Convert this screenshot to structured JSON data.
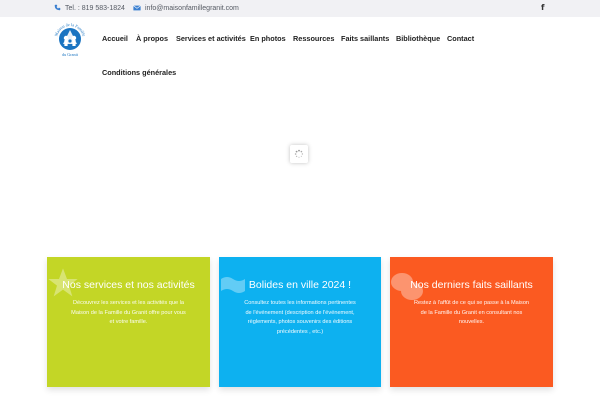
{
  "topbar": {
    "phone": "Tel. : 819 583-1824",
    "email": "info@maisonfamillegranit.com",
    "phone_icon": "phone-icon",
    "email_icon": "envelope-icon",
    "social_icon": "facebook-icon"
  },
  "logo": {
    "text_top": "Maison de la Famille",
    "text_bottom": "du Granit",
    "color": "#1a74c1"
  },
  "nav": {
    "items": [
      {
        "label": "Accueil"
      },
      {
        "label": "À propos"
      },
      {
        "label": "Services et activités"
      },
      {
        "label": "En photos"
      },
      {
        "label": "Ressources"
      },
      {
        "label": "Faits saillants"
      },
      {
        "label": "Bibliothèque"
      },
      {
        "label": "Contact"
      },
      {
        "label": "Conditions générales"
      }
    ]
  },
  "cards": [
    {
      "title": "Nos services et nos activités",
      "description": "Découvrez les services et les activités que la Maison de la Famille du Granit offre pour vous et votre famille.",
      "color": "#c3d626",
      "icon": "star-icon"
    },
    {
      "title": "Bolides en ville 2024 !",
      "description": "Consultez toutes les informations pertinentes de l'événement (description de l'événement, règlements, photos souvenirs des éditions précédentes , etc.)",
      "color": "#0db1f0",
      "icon": "flag-icon"
    },
    {
      "title": "Nos derniers faits saillants",
      "description": "Restez à l'affût de ce qui se passe à la Maison de la Famille du Granit en consultant nos nouvelles.",
      "color": "#fb5a21",
      "icon": "chat-bubbles-icon"
    }
  ]
}
